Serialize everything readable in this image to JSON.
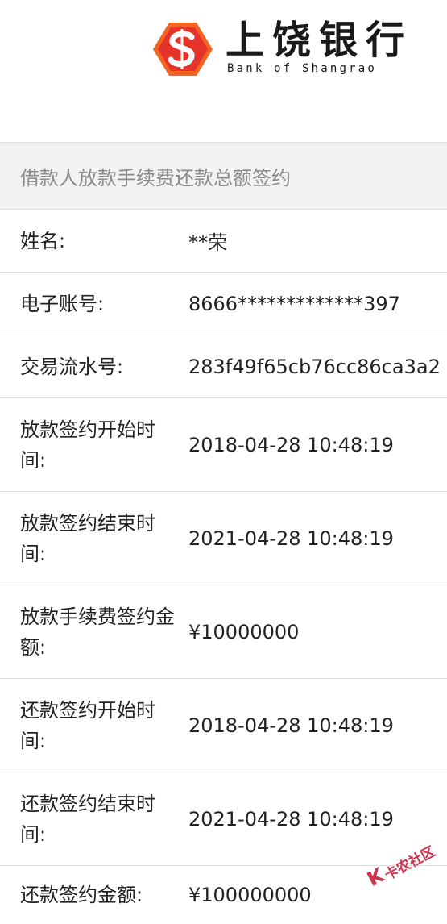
{
  "brand": {
    "name_cn": "上饶银行",
    "name_en": "Bank of Shangrao",
    "logo_icon": "bank-of-shangrao-logo",
    "logo_colors": [
      "#f26522",
      "#e5332a"
    ]
  },
  "section": {
    "title": "借款人放款手续费还款总额签约"
  },
  "rows": [
    {
      "label": "姓名:",
      "value": "**荣"
    },
    {
      "label": "电子账号:",
      "value": "8666*************397"
    },
    {
      "label": "交易流水号:",
      "value": "283f49f65cb76cc86ca3a2"
    },
    {
      "label": "放款签约开始时间:",
      "value": "2018-04-28 10:48:19"
    },
    {
      "label": "放款签约结束时间:",
      "value": "2021-04-28 10:48:19"
    },
    {
      "label": "放款手续费签约金额:",
      "value": "¥10000000"
    },
    {
      "label": "还款签约开始时间:",
      "value": "2018-04-28 10:48:19"
    },
    {
      "label": "还款签约结束时间:",
      "value": "2021-04-28 10:48:19"
    },
    {
      "label": "还款签约金额:",
      "value": "¥100000000"
    }
  ],
  "watermark": {
    "text": "卡农社区",
    "icon": "kanong-k-icon",
    "color": "#c8102e"
  }
}
